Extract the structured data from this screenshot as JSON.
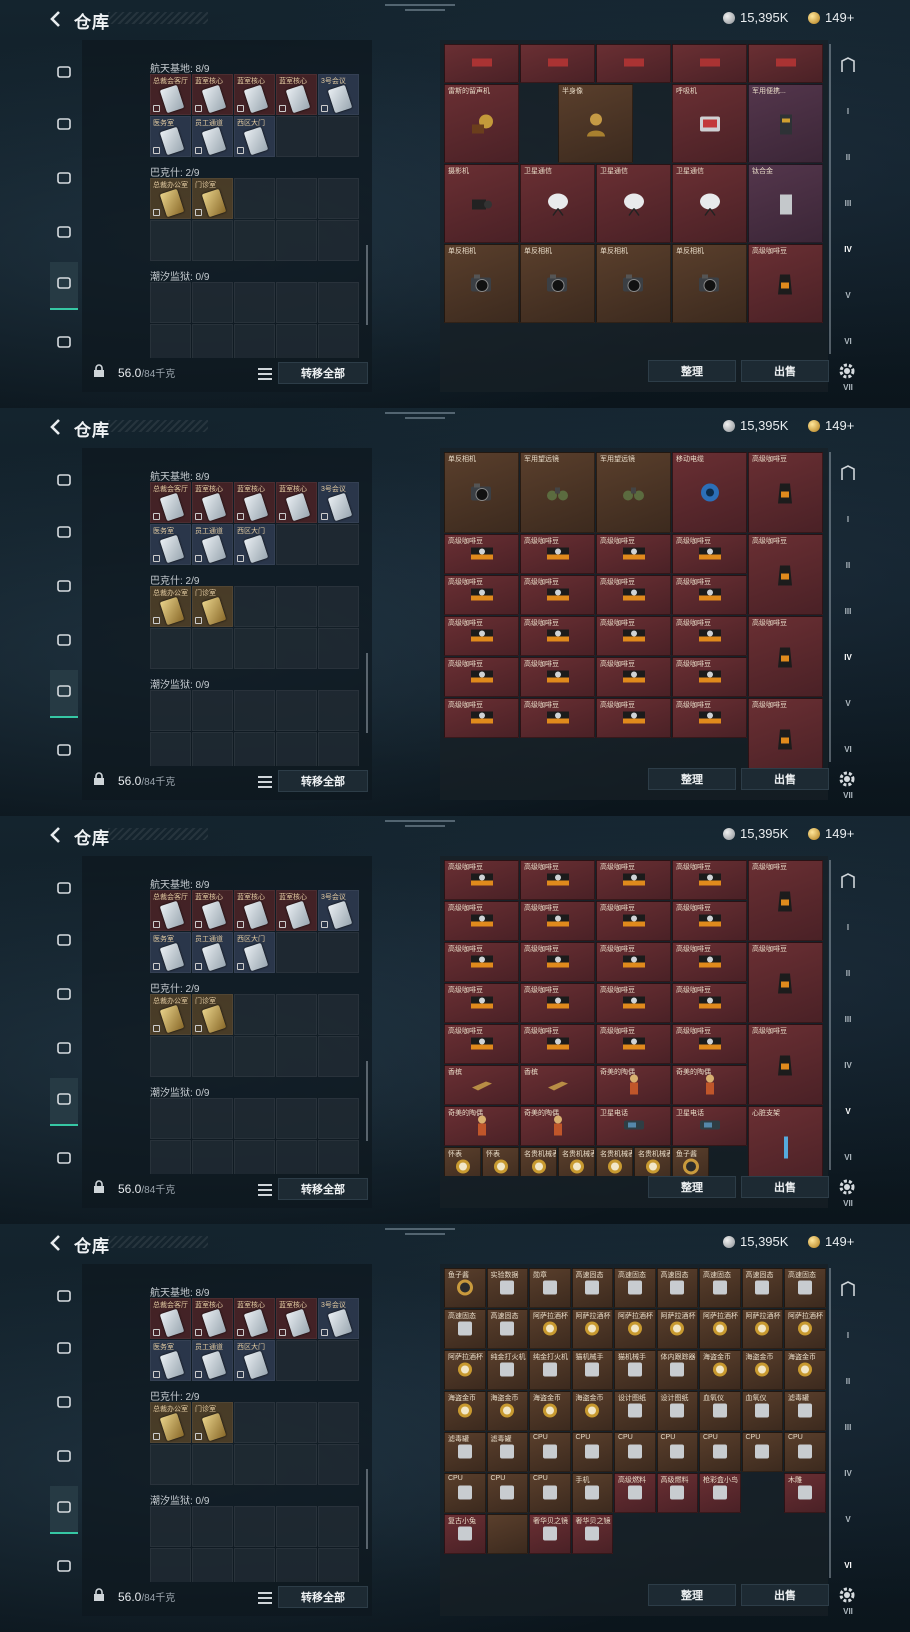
{
  "header": {
    "title": "仓库",
    "silver_amount": "15,395K",
    "gold_amount": "149+"
  },
  "left_panel": {
    "regions": [
      {
        "label": "航天基地: 8/9",
        "items": [
          "总裁会客厅",
          "蓝室核心",
          "蓝室核心",
          "蓝室核心",
          "3号会议",
          "医务室",
          "员工通道",
          "西区大门"
        ]
      },
      {
        "label": "巴克什: 2/9",
        "items": [
          "总裁办公室",
          "门诊室"
        ]
      },
      {
        "label": "潮汐监狱: 0/9",
        "items": []
      }
    ],
    "weight": "56.0",
    "weight_cap": "/84千克",
    "transfer_all": "转移全部"
  },
  "buttons": {
    "sort": "整理",
    "sell": "出售"
  },
  "right_rail": [
    "I",
    "II",
    "III",
    "IV",
    "V",
    "VI",
    "VII"
  ],
  "screens": [
    {
      "active_tab": 3,
      "items": [
        {
          "name": "",
          "w": 1,
          "h": 1,
          "color": "red",
          "icon": "tool-icon"
        },
        {
          "name": "",
          "w": 1,
          "h": 1,
          "color": "red",
          "icon": "tool-icon"
        },
        {
          "name": "",
          "w": 1,
          "h": 1,
          "color": "red",
          "icon": "tool-icon"
        },
        {
          "name": "",
          "w": 1,
          "h": 1,
          "color": "red",
          "icon": "tool-icon"
        },
        {
          "name": "",
          "w": 1,
          "h": 1,
          "color": "red",
          "icon": "tool-icon"
        },
        {
          "name": "雷斯的留声机",
          "w": 2,
          "h": 1,
          "color": "red",
          "icon": "gramophone-icon"
        },
        {
          "name": "半身像",
          "w": 2,
          "h": 1,
          "color": "brown",
          "icon": "bust-icon"
        },
        {
          "name": "呼吸机",
          "w": 1,
          "h": 1,
          "color": "red",
          "icon": "device-icon"
        },
        {
          "name": "军用便携...",
          "w": 1,
          "h": 1,
          "color": "purple",
          "icon": "radio-icon"
        },
        {
          "name": "摄影机",
          "w": 1,
          "h": 1,
          "color": "red",
          "icon": "camcorder-icon"
        },
        {
          "name": "卫星通信",
          "w": 1,
          "h": 1,
          "color": "red",
          "icon": "dish-icon"
        },
        {
          "name": "卫星通信",
          "w": 1,
          "h": 1,
          "color": "red",
          "icon": "dish-icon"
        },
        {
          "name": "卫星通信",
          "w": 1,
          "h": 1,
          "color": "red",
          "icon": "dish-icon"
        },
        {
          "name": "钛合金",
          "w": 1,
          "h": 1,
          "color": "purple",
          "icon": "plate-icon"
        },
        {
          "name": "单反相机",
          "w": 1,
          "h": 1,
          "color": "brown",
          "icon": "camera-icon"
        },
        {
          "name": "单反相机",
          "w": 1,
          "h": 1,
          "color": "brown",
          "icon": "camera-icon"
        },
        {
          "name": "单反相机",
          "w": 1,
          "h": 1,
          "color": "brown",
          "icon": "camera-icon"
        },
        {
          "name": "单反相机",
          "w": 1,
          "h": 1,
          "color": "brown",
          "icon": "camera-icon"
        },
        {
          "name": "高级咖啡豆",
          "w": 1,
          "h": 1,
          "color": "red",
          "icon": "coffee-bag-icon"
        }
      ]
    },
    {
      "active_tab": 3,
      "items": [
        {
          "name": "单反相机",
          "color": "brown",
          "icon": "camera-icon"
        },
        {
          "name": "军用望远镜",
          "color": "brown",
          "icon": "binoculars-icon"
        },
        {
          "name": "军用望远镜",
          "color": "brown",
          "icon": "binoculars-icon"
        },
        {
          "name": "移动电缆",
          "color": "red",
          "icon": "cable-reel-icon"
        },
        {
          "name": "高级咖啡豆",
          "color": "red",
          "icon": "coffee-bag-icon"
        },
        {
          "name": "高级咖啡豆",
          "color": "red",
          "icon": "coffee-box-icon"
        },
        {
          "name": "高级咖啡豆",
          "color": "red",
          "icon": "coffee-box-icon"
        },
        {
          "name": "高级咖啡豆",
          "color": "red",
          "icon": "coffee-box-icon"
        },
        {
          "name": "高级咖啡豆",
          "color": "red",
          "icon": "coffee-box-icon"
        },
        {
          "name": "高级咖啡豆",
          "color": "red",
          "icon": "coffee-bag-icon"
        }
      ]
    },
    {
      "active_tab": 4,
      "items": [
        {
          "name": "高级咖啡豆",
          "color": "red",
          "icon": "coffee-box-icon"
        },
        {
          "name": "香槟",
          "color": "red",
          "icon": "bottle-icon"
        },
        {
          "name": "奇美的陶偶",
          "color": "red",
          "icon": "figurine-icon"
        },
        {
          "name": "卫星电话",
          "color": "red",
          "icon": "phone-icon"
        },
        {
          "name": "心脏支架",
          "color": "red",
          "icon": "stent-icon"
        },
        {
          "name": "怀表",
          "color": "brown",
          "icon": "watch-icon"
        },
        {
          "name": "名贵机械表",
          "color": "brown",
          "icon": "watch-icon"
        },
        {
          "name": "名贵机械表",
          "color": "brown",
          "icon": "watch-icon"
        },
        {
          "name": "名贵机械表",
          "color": "brown",
          "icon": "watch-icon"
        },
        {
          "name": "名贵机械表",
          "color": "brown",
          "icon": "watch-icon"
        },
        {
          "name": "鱼子酱",
          "color": "brown",
          "icon": "can-icon"
        }
      ]
    },
    {
      "active_tab": 5,
      "rows": [
        [
          "鱼子酱",
          "实验数据",
          "勋章",
          "高速固态",
          "高速固态",
          "高速固态",
          "高速固态",
          "高速固态",
          "高速固态"
        ],
        [
          "高速固态",
          "高速固态",
          "阿萨拉酒杯",
          "阿萨拉酒杯",
          "阿萨拉酒杯",
          "阿萨拉酒杯",
          "阿萨拉酒杯",
          "阿萨拉酒杯",
          "阿萨拉酒杯"
        ],
        [
          "阿萨拉酒杯",
          "纯金打火机",
          "纯金打火机",
          "猫机械手",
          "猫机械手",
          "体内跟踪器",
          "海盗金币",
          "海盗金币",
          "海盗金币"
        ],
        [
          "海盗金币",
          "海盗金币",
          "海盗金币",
          "海盗金币",
          "设计图纸",
          "设计图纸",
          "血氧仪",
          "血氧仪",
          "滤毒罐"
        ],
        [
          "滤毒罐",
          "滤毒罐",
          "CPU",
          "CPU",
          "CPU",
          "CPU",
          "CPU",
          "CPU",
          "CPU"
        ],
        [
          "CPU",
          "CPU",
          "CPU",
          "手机",
          "高级燃料",
          "高级燃料",
          "枪彩盒小鸟",
          "",
          "木雕"
        ],
        [
          "复古小兔",
          "",
          "奢华贝之镜",
          "奢华贝之镜",
          "",
          "",
          "",
          "",
          ""
        ]
      ]
    }
  ],
  "colors": {
    "accent": "#36c7a4",
    "item_red": "#6a2f33",
    "item_brown": "#5a3f2c",
    "item_purple": "#54364c"
  }
}
